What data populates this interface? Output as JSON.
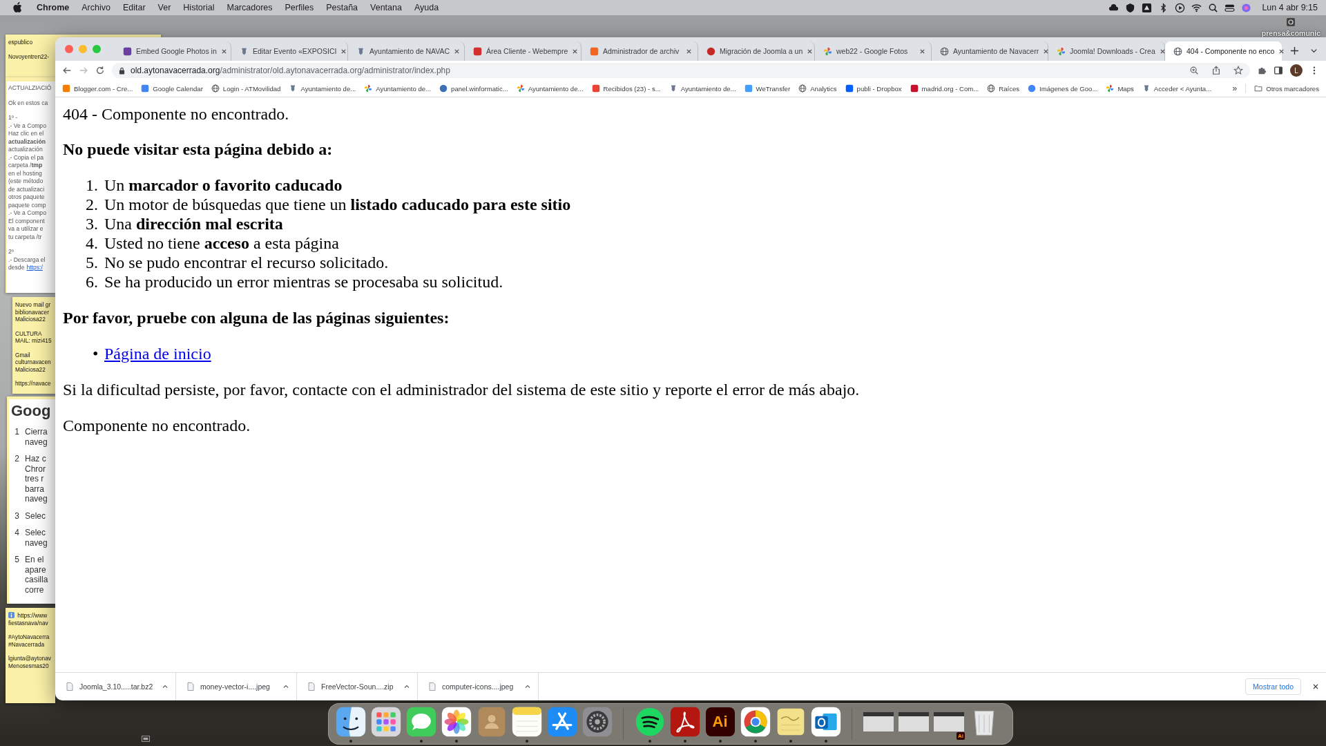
{
  "menu_bar": {
    "app": "Chrome",
    "menus": [
      "Archivo",
      "Editar",
      "Ver",
      "Historial",
      "Marcadores",
      "Perfiles",
      "Pestaña",
      "Ventana",
      "Ayuda"
    ],
    "clock": "Lun 4 abr  9:15"
  },
  "desktop_icon": {
    "label": "prensa&comunic"
  },
  "sticky_notes": [
    {
      "kind": "plain",
      "paragraphs": [
        "espublico",
        "Novoyentren22-"
      ]
    },
    {
      "kind": "doc",
      "paragraphs": [
        {
          "text": "ACTUALZIACIÓ"
        },
        {
          "text": "Ok en estos ca"
        },
        {
          "text": "1º -\n.- Ve a Compo\nHaz clic en el\n**actualización**\nactualización\n.- Copia el pa\ncarpeta /**tmp**\nen el hosting\n(este método\nde actualizaci\notros paquete\npaquete comp\n.- Ve a Compo\nEl component\nva a utilizar e\ntu carpeta /tr"
        },
        {
          "text": "2º\n.- Descarga el",
          "link_prefix": "desde",
          "link": "https:/"
        }
      ]
    },
    {
      "kind": "plain",
      "paragraphs": [
        "Nuevo mail gr\nbiblionavacer\nMaliciosa22",
        "CULTURA\nMAIL: mizi415",
        "Gmail\nculturnavacen\nMaliciosa22",
        "https://navace"
      ]
    },
    {
      "kind": "steps",
      "heading": "Goog",
      "steps": [
        {
          "number": "1",
          "text": "Cierra\nnaveg"
        },
        {
          "number": "2",
          "text": "Haz c\nChror\ntres r\nbarra\nnaveg"
        },
        {
          "number": "3",
          "text": "Selec"
        },
        {
          "number": "4",
          "text": "Selec\nnaveg"
        },
        {
          "number": "5",
          "text": "En el\napare\ncasilla\ncorre"
        }
      ]
    },
    {
      "kind": "plain",
      "info": true,
      "paragraphs": [
        "https://www\nfiestasnava/nav",
        "#AytoNavacerra\n#Navacerrada",
        "lgiunta@aytonav\nMenosesmas20"
      ]
    }
  ],
  "browser": {
    "tabs": [
      {
        "title": "Embed Google Photos in",
        "kind": "square",
        "color": "#6b3fa0",
        "selected": false
      },
      {
        "title": "Editar Evento «EXPOSICI",
        "kind": "crest",
        "selected": false
      },
      {
        "title": "Ayuntamiento de NAVAC",
        "kind": "crest",
        "selected": false
      },
      {
        "title": "Área Cliente - Webempre",
        "kind": "square",
        "color": "#d32f2f",
        "selected": false
      },
      {
        "title": "Administrador de archiv",
        "kind": "square",
        "color": "#f26522",
        "selected": false
      },
      {
        "title": "Migración de Joomla a un",
        "kind": "circle",
        "color": "#c62828",
        "selected": false
      },
      {
        "title": "web22 - Google Fotos",
        "kind": "pinwheel",
        "selected": false
      },
      {
        "title": "Ayuntamiento de Navacerr",
        "kind": "globe",
        "selected": false
      },
      {
        "title": "Joomla! Downloads - Crea",
        "kind": "pinwheel",
        "selected": false
      },
      {
        "title": "404 - Componente no enco",
        "kind": "globe",
        "selected": true
      }
    ],
    "url": {
      "host": "old.aytonavacerrada.org",
      "path": "/administrator/old.aytonavacerrada.org/administrator/index.php"
    },
    "profile": "L",
    "bookmarks": [
      {
        "label": "Blogger.com - Cre...",
        "kind": "square",
        "color": "#f57d00"
      },
      {
        "label": "Google Calendar",
        "kind": "square",
        "color": "#4285f4"
      },
      {
        "label": "Login - ATMovilidad",
        "kind": "globe"
      },
      {
        "label": "Ayuntamiento de...",
        "kind": "crest"
      },
      {
        "label": "Ayuntamiento de...",
        "kind": "pinwheel"
      },
      {
        "label": "panel.winformatic...",
        "kind": "circle",
        "color": "#3b6fb6"
      },
      {
        "label": "Ayuntamiento de...",
        "kind": "pinwheel"
      },
      {
        "label": "Recibidos (23) - s...",
        "kind": "square",
        "color": "#ea4335"
      },
      {
        "label": "Ayuntamiento de...",
        "kind": "crest"
      },
      {
        "label": "WeTransfer",
        "kind": "square",
        "color": "#409fff"
      },
      {
        "label": "Analytics",
        "kind": "globe"
      },
      {
        "label": "publi - Dropbox",
        "kind": "square",
        "color": "#0061fe"
      },
      {
        "label": "madrid.org - Com...",
        "kind": "square",
        "color": "#c8102e"
      },
      {
        "label": "Raíces",
        "kind": "globe"
      },
      {
        "label": "Imágenes de Goo...",
        "kind": "circle",
        "color": "#4285f4"
      },
      {
        "label": "Maps",
        "kind": "pinwheel"
      },
      {
        "label": "Acceder < Ayunta...",
        "kind": "crest"
      }
    ],
    "more_bookmarks": "»",
    "other_bookmarks": "Otros marcadores",
    "page": {
      "title": "404 - Componente no encontrado.",
      "reasons_heading": "No puede visitar esta página debido a:",
      "reasons": [
        {
          "number": "1.",
          "text": "Un **marcador o favorito caducado**"
        },
        {
          "number": "2.",
          "text": "Un motor de búsquedas que tiene un **listado caducado para este sitio**"
        },
        {
          "number": "3.",
          "text": "Una **dirección mal escrita**"
        },
        {
          "number": "4.",
          "text": "Usted no tiene **acceso** a esta página"
        },
        {
          "number": "5.",
          "text": "No se pudo encontrar el recurso solicitado."
        },
        {
          "number": "6.",
          "text": "Se ha producido un error mientras se procesaba su solicitud."
        }
      ],
      "suggest_heading": "Por favor, pruebe con alguna de las páginas siguientes:",
      "links": [
        {
          "bullet": "•",
          "text": "Página de inicio"
        }
      ],
      "contact_text": "Si la dificultad persiste, por favor, contacte con el administrador del sistema de este sitio y reporte el error de más abajo.",
      "error_text": "Componente no encontrado."
    },
    "downloads": [
      {
        "name": "Joomla_3.10.....tar.bz2"
      },
      {
        "name": "money-vector-i....jpeg"
      },
      {
        "name": "FreeVector-Soun....zip"
      },
      {
        "name": "computer-icons....jpeg"
      }
    ],
    "show_all": "Mostrar todo"
  },
  "dock": [
    {
      "kind": "finder",
      "running": true
    },
    {
      "kind": "launchpad",
      "running": false
    },
    {
      "kind": "messages",
      "running": true
    },
    {
      "kind": "photos",
      "running": true
    },
    {
      "kind": "contacts",
      "running": false
    },
    {
      "kind": "notes",
      "running": true
    },
    {
      "kind": "appstore",
      "running": false
    },
    {
      "kind": "settings",
      "running": false
    },
    {
      "kind": "separator"
    },
    {
      "kind": "spotify",
      "running": true
    },
    {
      "kind": "acrobat",
      "running": true
    },
    {
      "kind": "illustrator",
      "text": "Ai",
      "running": true
    },
    {
      "kind": "chrome",
      "running": true
    },
    {
      "kind": "stickies",
      "running": true
    },
    {
      "kind": "outlook",
      "running": true
    },
    {
      "kind": "separator"
    },
    {
      "kind": "window",
      "running": false
    },
    {
      "kind": "window",
      "running": false
    },
    {
      "kind": "window",
      "badge": "Ai",
      "running": false
    },
    {
      "kind": "trash",
      "running": false
    }
  ]
}
